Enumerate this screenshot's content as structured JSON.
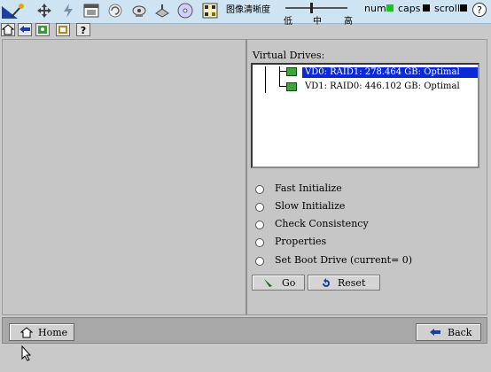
{
  "toolbar": {
    "image_quality_label": "图像清晰度",
    "quality_low": "低",
    "quality_mid": "中",
    "quality_high": "高",
    "num_label": "num",
    "caps_label": "caps",
    "scroll_label": "scroll",
    "num_color": "#1fc21f",
    "caps_color": "#000000",
    "scroll_color": "#000000"
  },
  "virtual_drives": {
    "label": "Virtual Drives:",
    "items": [
      {
        "text": "VD0: RAID1: 278.464 GB: Optimal",
        "selected": true
      },
      {
        "text": "VD1: RAID0: 446.102 GB: Optimal",
        "selected": false
      }
    ]
  },
  "options": [
    "Fast Initialize",
    "Slow Initialize",
    "Check Consistency",
    "Properties",
    "Set Boot Drive (current= 0)"
  ],
  "buttons": {
    "go": "Go",
    "reset": "Reset",
    "home": "Home",
    "back": "Back"
  }
}
